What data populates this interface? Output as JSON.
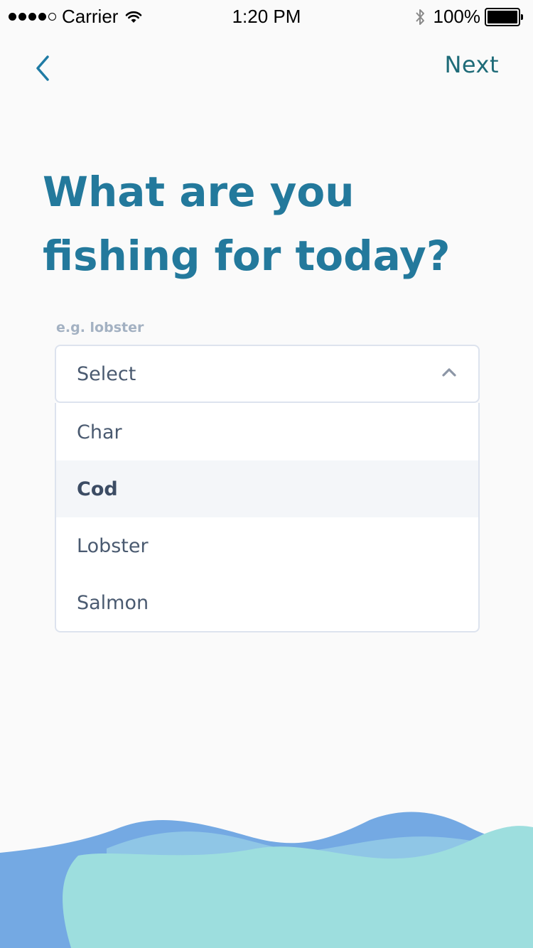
{
  "status_bar": {
    "carrier": "Carrier",
    "time": "1:20 PM",
    "battery": "100%"
  },
  "nav": {
    "next_label": "Next"
  },
  "page": {
    "title": "What are you fishing for today?"
  },
  "select": {
    "hint": "e.g. lobster",
    "value": "Select",
    "options": [
      "Char",
      "Cod",
      "Lobster",
      "Salmon"
    ],
    "selected_option": "Cod"
  },
  "colors": {
    "title": "#23799c",
    "next": "#1e6b78",
    "back_icon": "#1f7ba4",
    "wave_back": "#74a9e3",
    "wave_mid": "#8fc6e6",
    "wave_front": "#9ddede"
  },
  "icons": {
    "back": "chevron-left-icon",
    "select": "chevron-up-icon",
    "wifi": "wifi-icon",
    "bluetooth": "bluetooth-icon",
    "battery": "battery-icon"
  }
}
